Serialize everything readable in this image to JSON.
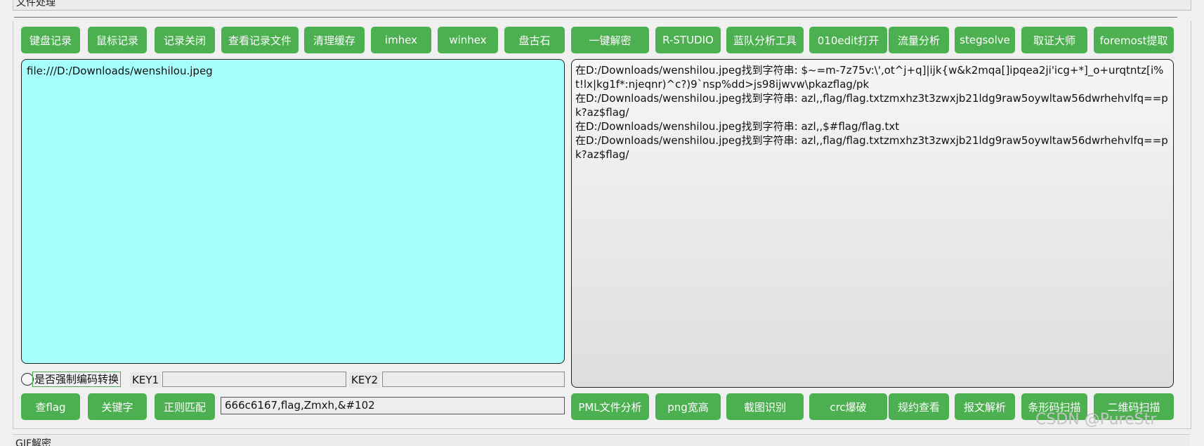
{
  "section_title": "文件处理",
  "next_section_title": "GIF解密",
  "toolbar": [
    "键盘记录",
    "鼠标记录",
    "记录关闭",
    "查看记录文件",
    "清理缓存",
    "imhex",
    "winhex",
    "盘古石",
    "一键解密",
    "R-STUDIO",
    "蓝队分析工具",
    "010edit打开",
    "流量分析",
    "stegsolve",
    "取证大师",
    "foremost提取"
  ],
  "input_text": "file:///D:/Downloads/wenshilou.jpeg",
  "output_lines": [
    "在D:/Downloads/wenshilou.jpeg找到字符串: $~=m-7z75v:\\',ot^j+q]|ijk{w&k2mqa[]ipqea2ji'icg+*]_o+urqtntz[i%t!lx|kg1f*:njeqnr)^c?)9`nsp%dd>js98ijwvw\\pkazflag/pk",
    "在D:/Downloads/wenshilou.jpeg找到字符串: azl,,flag/flag.txtzmxhz3t3zwxjb21ldg9raw5oywltaw56dwrhehvlfq==pk?az$flag/",
    "在D:/Downloads/wenshilou.jpeg找到字符串: azl,,$#flag/flag.txt",
    "在D:/Downloads/wenshilou.jpeg找到字符串: azl,,flag/flag.txtzmxhz3t3zwxjb21ldg9raw5oywltaw56dwrhehvlfq==pk?az$flag/"
  ],
  "options": {
    "force_encoding_label": "是否强制编码转换",
    "key1_label": "KEY1",
    "key2_label": "KEY2",
    "key1_value": "",
    "key2_value": ""
  },
  "search": {
    "find_flag_label": "查flag",
    "keyword_label": "关键字",
    "regex_label": "正则匹配",
    "value": "666c6167,flag,Zmxh,&#102"
  },
  "bottom_tools": [
    "PML文件分析",
    "png宽高",
    "截图识别",
    "crc爆破",
    "规约查看",
    "报文解析",
    "条形码扫描",
    "二维码扫描"
  ],
  "watermark": "CSDN @PureStr",
  "colors": {
    "button_green": "#4caf50",
    "input_cyan": "#a6fffc"
  }
}
